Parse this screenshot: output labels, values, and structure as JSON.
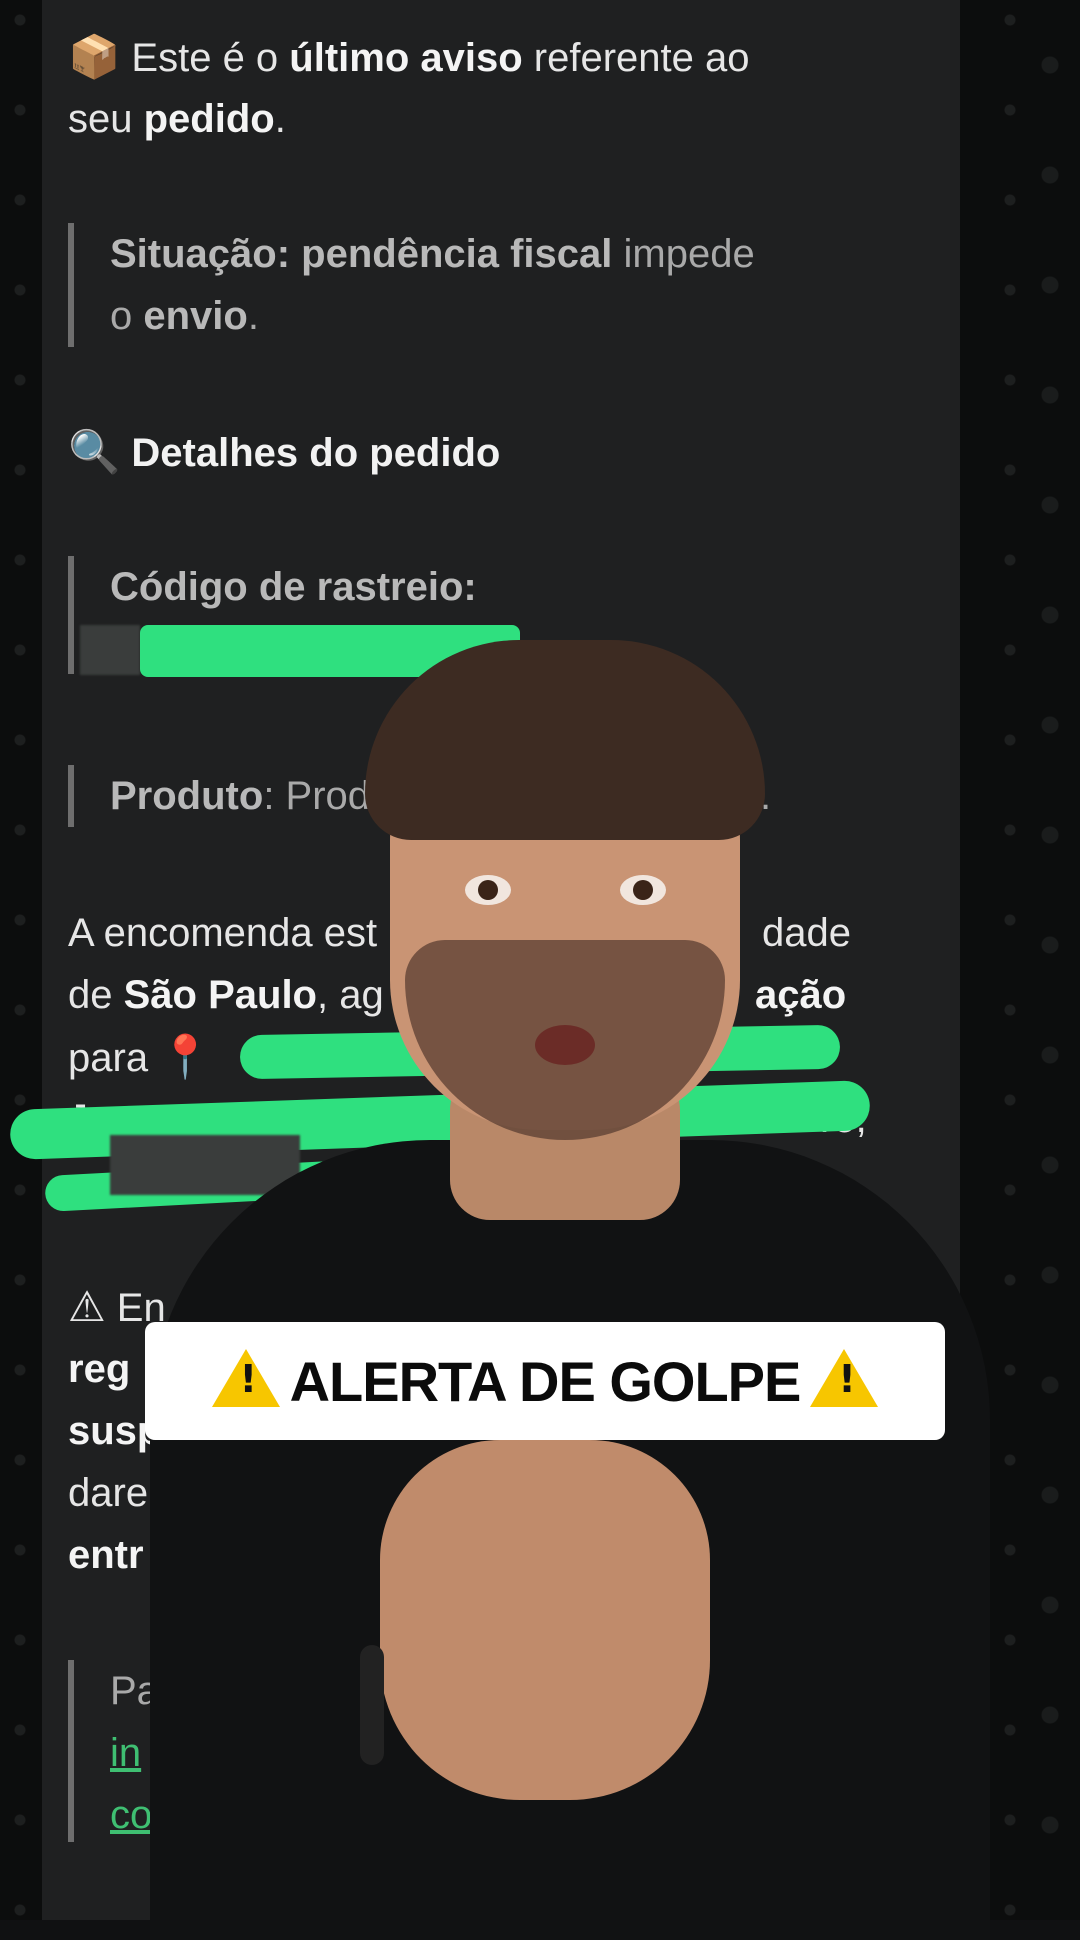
{
  "chat": {
    "intro": {
      "icon": "package-emoji",
      "icon_glyph": "📦",
      "p1": "Este é o ",
      "b1": "último aviso",
      "p2": " referente ao",
      "p3": "seu ",
      "b2": "pedido",
      "p4": "."
    },
    "situation": {
      "b1": "Situação: pendência fiscal",
      "p1": " impede",
      "p2": "o ",
      "b2": "envio",
      "p3": "."
    },
    "details_title": {
      "icon": "magnifier-emoji",
      "icon_glyph": "🔍",
      "text": "Detalhes do pedido"
    },
    "tracking": {
      "label": "Código de rastreio:"
    },
    "product": {
      "label": "Produto",
      "value": ": Produ",
      "tail": "."
    },
    "parcel": {
      "l1a": "A encomenda est",
      "l1b": "dade",
      "l2a": "de ",
      "l2b": "São Paulo",
      "l2c": ", ag",
      "l2d": "ação",
      "l3": "para ",
      "pin_glyph": "📍",
      "l4a": "Ja",
      "l4b": "ro,"
    },
    "warning": {
      "icon_glyph": "⚠",
      "l1": "En",
      "l2": "reg",
      "l3": "susp",
      "l4": "dare",
      "l5": "entr"
    },
    "link_quote": {
      "l1": "Pa",
      "l2": "in",
      "l3": "com/"
    }
  },
  "caption": {
    "text": "ALERTA DE GOLPE"
  }
}
